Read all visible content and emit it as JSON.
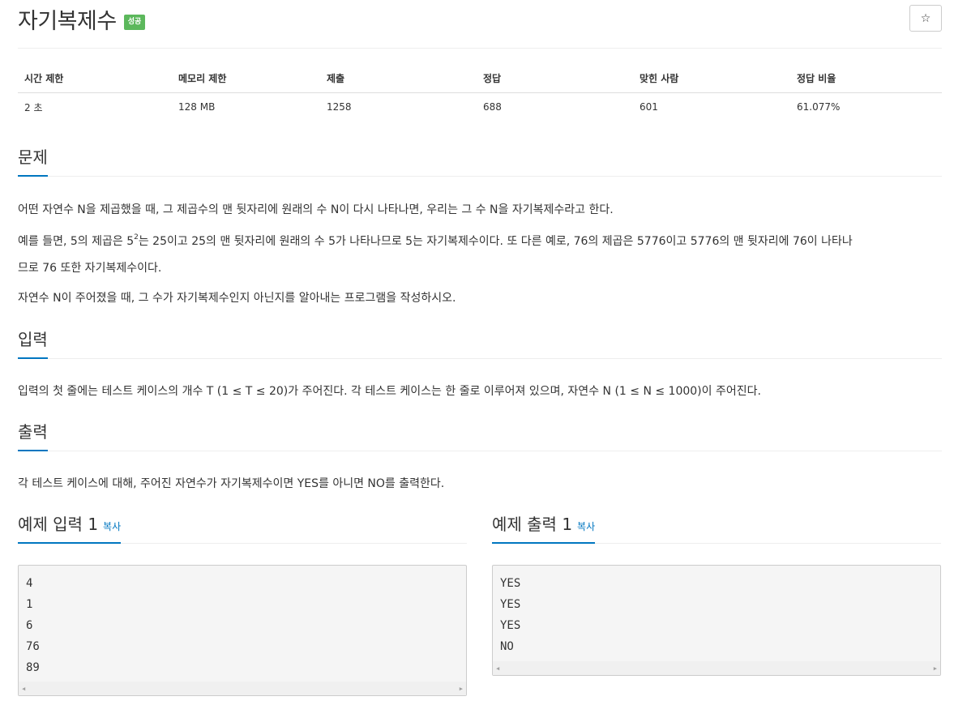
{
  "header": {
    "title": "자기복제수",
    "badge": "성공",
    "star_icon": "☆"
  },
  "info_table": {
    "columns": [
      "시간 제한",
      "메모리 제한",
      "제출",
      "정답",
      "맞힌 사람",
      "정답 비율"
    ],
    "values": [
      "2 초",
      "128 MB",
      "1258",
      "688",
      "601",
      "61.077%"
    ]
  },
  "problem": {
    "heading": "문제",
    "p1": "어떤 자연수 N을 제곱했을 때, 그 제곱수의 맨 뒷자리에 원래의 수 N이 다시 나타나면, 우리는 그 수 N을 자기복제수라고 한다.",
    "p2_before_sup": "예를 들면, 5의 제곱은 5",
    "p2_sup": "2",
    "p2_after_sup": "는 25이고 25의 맨 뒷자리에 원래의 수 5가 나타나므로 5는 자기복제수이다. 또 다른 예로, 76의 제곱은 5776이고 5776의 맨 뒷자리에 76이 나타나",
    "p2_line2": "므로 76 또한 자기복제수이다.",
    "p3": "자연수 N이 주어졌을 때, 그 수가 자기복제수인지 아닌지를 알아내는 프로그램을 작성하시오."
  },
  "input": {
    "heading": "입력",
    "text": "입력의 첫 줄에는 테스트 케이스의 개수 T (1 ≤ T ≤ 20)가 주어진다. 각 테스트 케이스는 한 줄로 이루어져 있으며, 자연수 N (1 ≤ N ≤ 1000)이 주어진다."
  },
  "output": {
    "heading": "출력",
    "text": "각 테스트 케이스에 대해, 주어진 자연수가 자기복제수이면 YES를 아니면 NO를 출력한다."
  },
  "samples": {
    "input_title": "예제 입력 1",
    "output_title": "예제 출력 1",
    "copy_label": "복사",
    "input_lines": [
      "4",
      "1",
      "6",
      "76",
      "89"
    ],
    "output_lines": [
      "YES",
      "YES",
      "YES",
      "NO"
    ],
    "scroll_left": "◀",
    "scroll_right": "▶"
  }
}
